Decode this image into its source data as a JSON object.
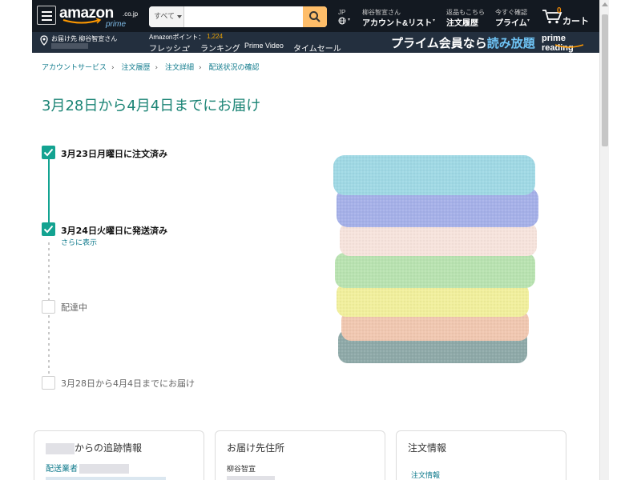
{
  "header": {
    "logo_word": "amazon",
    "logo_domain": ".co.jp",
    "logo_prime": "prime",
    "deliver_to": "お届け先 柳谷智宣さん",
    "search_category": "すべて",
    "search_placeholder": "",
    "lang_code": "JP",
    "account_greeting": "柳谷智宣さん",
    "account_label": "アカウント&リスト",
    "orders_top": "返品もこちら",
    "orders_label": "注文履歴",
    "prime_top": "今すぐ確認",
    "prime_label": "プライム",
    "cart_count": "0",
    "cart_label": "カート",
    "points_label": "Amazonポイント：",
    "points_value": "1,224",
    "nav_items": [
      "フレッシュ",
      "ランキング",
      "Prime Video",
      "タイムセール"
    ],
    "banner_text": "プライム会員なら",
    "banner_highlight": "読み放題",
    "prime_reading": "prime reading"
  },
  "breadcrumb": [
    "アカウントサービス",
    "注文履歴",
    "注文詳細",
    "配送状況の確認"
  ],
  "page_title": "3月28日から4月4日までにお届け",
  "timeline": {
    "step1": "3月23日月曜日に注文済み",
    "step2": "3月24日火曜日に発送済み",
    "step2_link": "さらに表示",
    "step3": "配達中",
    "step4": "3月28日から4月4日までにお届け"
  },
  "cards": {
    "tracking_title": "からの追跡情報",
    "tracking_carrier": "配送業者",
    "address_title": "お届け先住所",
    "address_name": "柳谷智宣",
    "order_title": "注文情報",
    "order_link": "注文情報"
  },
  "colors": {
    "accent": "#13a391",
    "title": "#1b8475",
    "link": "#0f7a8c",
    "header": "#232f3e",
    "header_top": "#131921",
    "search_button": "#febd69"
  }
}
